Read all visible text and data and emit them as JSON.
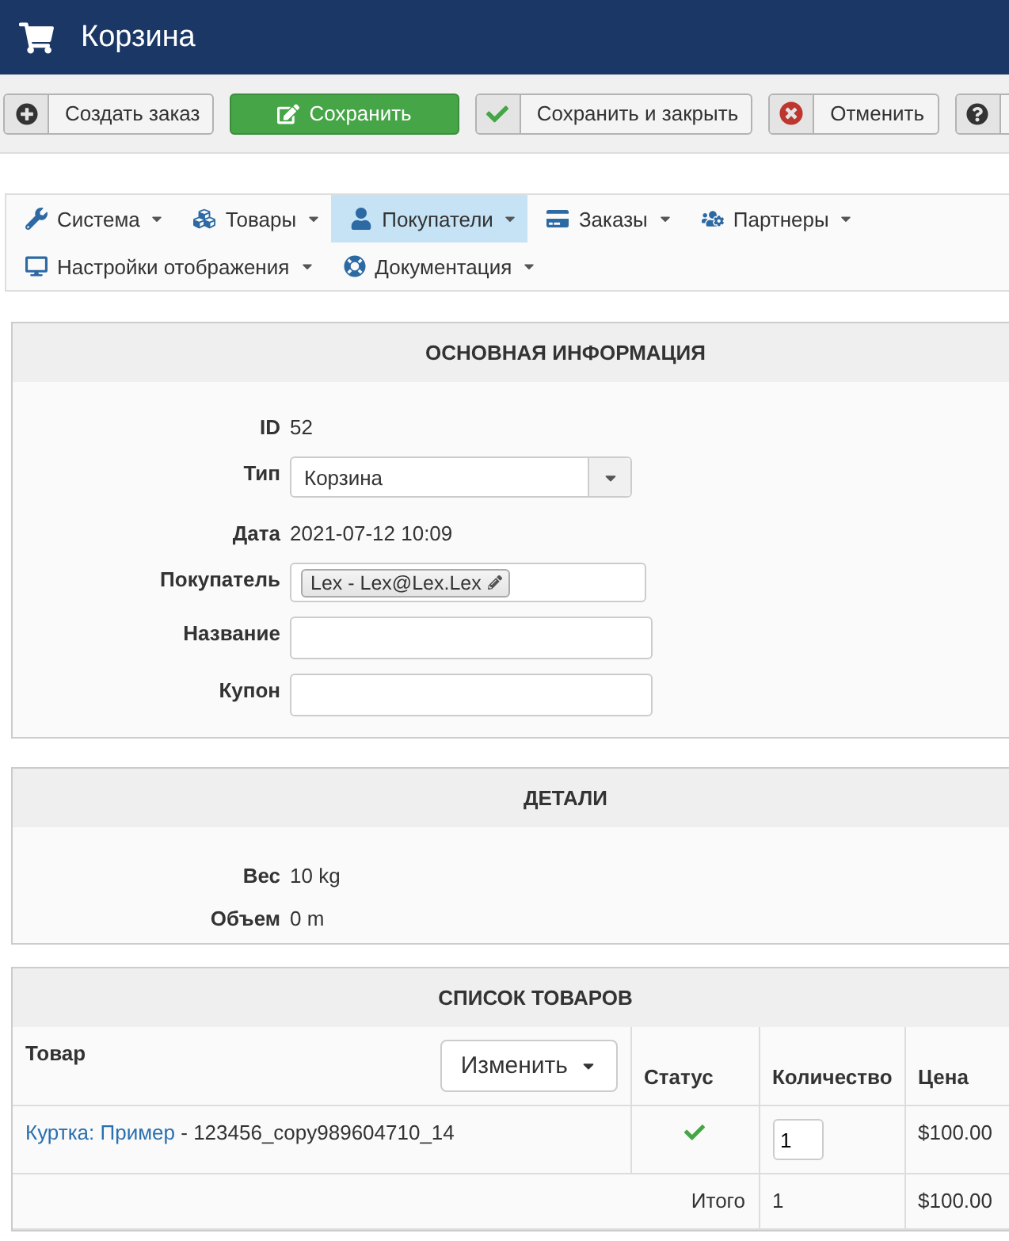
{
  "header": {
    "title": "Корзина"
  },
  "toolbar": [
    {
      "kind": "new",
      "label": "Создать заказ"
    },
    {
      "kind": "save",
      "label": "Сохранить"
    },
    {
      "kind": "save_close",
      "label": "Сохранить и закрыть"
    },
    {
      "kind": "cancel",
      "label": "Отменить"
    },
    {
      "kind": "help"
    }
  ],
  "menu": [
    {
      "label": "Система",
      "selected": false
    },
    {
      "label": "Товары",
      "selected": false
    },
    {
      "label": "Покупатели",
      "selected": true
    },
    {
      "label": "Заказы",
      "selected": false
    },
    {
      "label": "Партнеры",
      "selected": false
    },
    {
      "label": "Настройки отображения",
      "selected": false
    },
    {
      "label": "Документация",
      "selected": false
    }
  ],
  "main_info": {
    "title": "ОСНОВНАЯ ИНФОРМАЦИЯ",
    "fields": [
      {
        "kind": "text",
        "label": "ID",
        "value": "52"
      },
      {
        "kind": "select",
        "label": "Тип",
        "value": "Корзина"
      },
      {
        "kind": "text",
        "label": "Дата",
        "value": "2021-07-12 10:09"
      },
      {
        "kind": "tags",
        "label": "Покупатель",
        "tags": [
          "Lex - Lex@Lex.Lex"
        ]
      },
      {
        "kind": "input",
        "label": "Название"
      },
      {
        "kind": "input",
        "label": "Купон"
      }
    ]
  },
  "details": {
    "title": "ДЕТАЛИ",
    "fields": [
      {
        "kind": "text",
        "label": "Вес",
        "value": "10 kg"
      },
      {
        "kind": "text",
        "label": "Объем",
        "value": "0 m"
      }
    ]
  },
  "products": {
    "title": "СПИСОК ТОВАРОВ",
    "columns": [
      "Товар",
      "Статус",
      "Количество",
      "Цена"
    ],
    "edit_button": "Изменить",
    "rows": [
      {
        "name": "Куртка: Пример",
        "code": "- 123456_copy989604710_14",
        "status_ok": true,
        "quantity": "1",
        "price": "$100.00"
      }
    ],
    "total": {
      "label": "Итого",
      "quantity": "1",
      "price": "$100.00"
    }
  }
}
